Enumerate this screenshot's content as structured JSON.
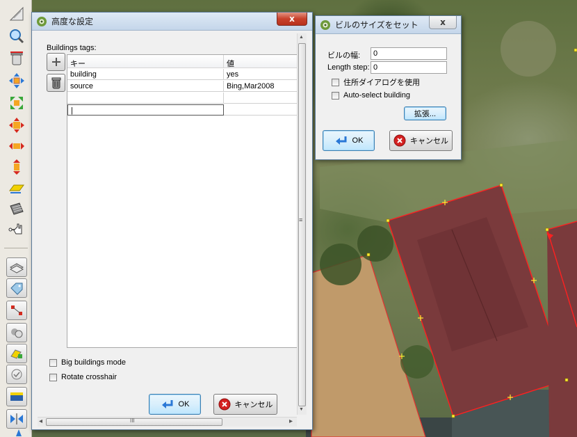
{
  "toolbar": {
    "items": [
      {
        "name": "draw-icon"
      },
      {
        "name": "zoom-icon"
      },
      {
        "name": "delete-icon"
      },
      {
        "name": "move-icon"
      },
      {
        "name": "rotate-icon"
      },
      {
        "name": "scale-icon"
      },
      {
        "name": "expand-horizontal-icon"
      },
      {
        "name": "expand-vertical-icon"
      },
      {
        "name": "parallel-icon"
      },
      {
        "name": "buildings-icon"
      },
      {
        "name": "select-hand-icon"
      },
      {
        "name": "layers-icon"
      },
      {
        "name": "tags-icon"
      },
      {
        "name": "relation-icon"
      },
      {
        "name": "filter-icon"
      },
      {
        "name": "paint-icon"
      },
      {
        "name": "validation-icon"
      },
      {
        "name": "imagery-icon"
      },
      {
        "name": "split-icon"
      }
    ]
  },
  "advanced_dialog": {
    "title": "高度な設定",
    "close_label": "x",
    "tags_label": "Buildings tags:",
    "add_label": "+",
    "columns": {
      "key": "キー",
      "value": "値"
    },
    "rows": [
      {
        "key": "building",
        "value": "yes"
      },
      {
        "key": "source",
        "value": "Bing,Mar2008"
      },
      {
        "key": "",
        "value": ""
      },
      {
        "key": "|",
        "value": ""
      }
    ],
    "big_buildings_mode": "Big buildings mode",
    "rotate_crosshair": "Rotate crosshair",
    "ok_label": "OK",
    "cancel_label": "キャンセル",
    "scroll_grip": "≡",
    "hscroll_grip": "III",
    "arrow_up": "▲",
    "arrow_down": "▼",
    "arrow_left": "◂",
    "arrow_right": "▸"
  },
  "size_dialog": {
    "title": "ビルのサイズをセット",
    "close_label": "x",
    "width_label": "ビルの幅:",
    "width_value": "0",
    "length_label": "Length step:",
    "length_value": "0",
    "address_dialog": "住所ダイアログを使用",
    "auto_select": "Auto-select building",
    "expand_label": "拡張...",
    "ok_label": "OK",
    "cancel_label": "キャンセル"
  },
  "colors": {
    "building_fill": "#7a3a3c",
    "outline": "#ff2020",
    "cancel_red": "#d42020",
    "ok_blue": "#3b7fc4"
  }
}
